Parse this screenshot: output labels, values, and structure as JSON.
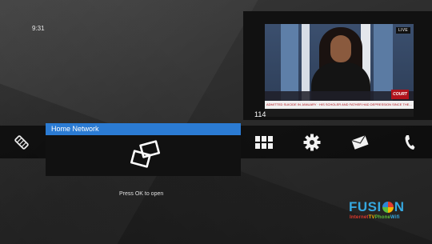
{
  "status": {
    "time": "9:31"
  },
  "preview": {
    "channel_number": "114",
    "live_badge": "LIVE",
    "network_logo_text": "COURT",
    "ticker_text": "ADMITTED SUICIDE IN JANUARY · HIS SCHOLER AND FATHER HAD DEPRESSION SINCE THE..."
  },
  "menu": {
    "items": [
      {
        "id": "tag",
        "icon": "tag-icon"
      },
      {
        "id": "home-network",
        "icon": "screens-icon",
        "label": "Home Network",
        "focused": true
      },
      {
        "id": "apps",
        "icon": "grid-icon"
      },
      {
        "id": "settings",
        "icon": "gear-icon"
      },
      {
        "id": "messages",
        "icon": "envelope-icon"
      },
      {
        "id": "phone",
        "icon": "phone-icon"
      }
    ]
  },
  "hint": "Press OK to open",
  "brand": {
    "name_prefix": "FUSI",
    "name_suffix": "N",
    "tag_internet": "Internet",
    "tag_tv": "TV",
    "tag_phone": "Phone",
    "tag_wifi": "Wifi",
    "colors": {
      "blue": "#36a8e0",
      "red": "#e23b2e",
      "yellow": "#f7b500",
      "green": "#5bbd3a"
    }
  },
  "colors": {
    "focus_header": "#2b7bd3",
    "menu_bar": "#000000"
  }
}
